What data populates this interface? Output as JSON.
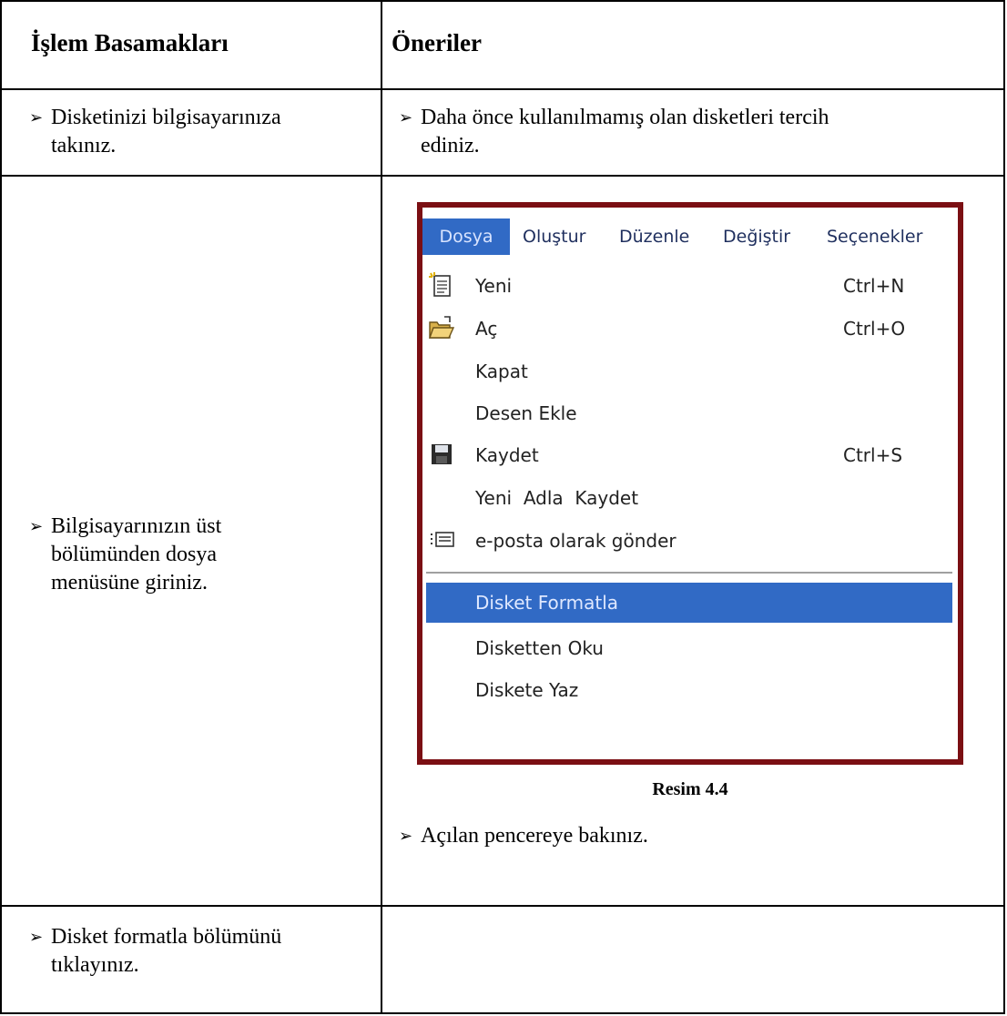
{
  "header": {
    "col1": "İşlem Basamakları",
    "col2": "Öneriler"
  },
  "rows": [
    {
      "step": [
        "Disketinizi bilgisayarınıza",
        "takınız."
      ],
      "tip": [
        "Daha önce kullanılmamış olan disketleri tercih",
        "ediniz."
      ]
    },
    {
      "step": [
        "Bilgisayarınızın üst",
        "bölümünden dosya",
        "menüsüne giriniz."
      ],
      "tip": [
        "Açılan pencereye bakınız."
      ]
    },
    {
      "step": [
        "Disket formatla bölümünü",
        "tıklayınız."
      ],
      "tip": []
    }
  ],
  "bullet": "➢",
  "menu": {
    "bar": [
      "Dosya",
      "Oluştur",
      "Düzenle",
      "Değiştir",
      "Seçenekler"
    ],
    "items": [
      {
        "label": "Yeni",
        "shortcut": "Ctrl+N",
        "icon": "new-document-icon"
      },
      {
        "label": "Aç",
        "shortcut": "Ctrl+O",
        "icon": "open-folder-icon"
      },
      {
        "label": "Kapat",
        "shortcut": "",
        "icon": ""
      },
      {
        "label": "Desen Ekle",
        "shortcut": "",
        "icon": ""
      },
      {
        "label": "Kaydet",
        "shortcut": "Ctrl+S",
        "icon": "floppy-save-icon"
      },
      {
        "label": "Yeni  Adla  Kaydet",
        "shortcut": "",
        "icon": ""
      },
      {
        "label": "e-posta olarak gönder",
        "shortcut": "",
        "icon": "email-send-icon"
      },
      {
        "label": "Disket Formatla",
        "shortcut": "",
        "icon": ""
      },
      {
        "label": "Disketten Oku",
        "shortcut": "",
        "icon": ""
      },
      {
        "label": "Diskete Yaz",
        "shortcut": "",
        "icon": ""
      }
    ],
    "highlight_color": "#316ac5",
    "frame_color": "#7b0f13"
  },
  "caption": "Resim 4.4"
}
